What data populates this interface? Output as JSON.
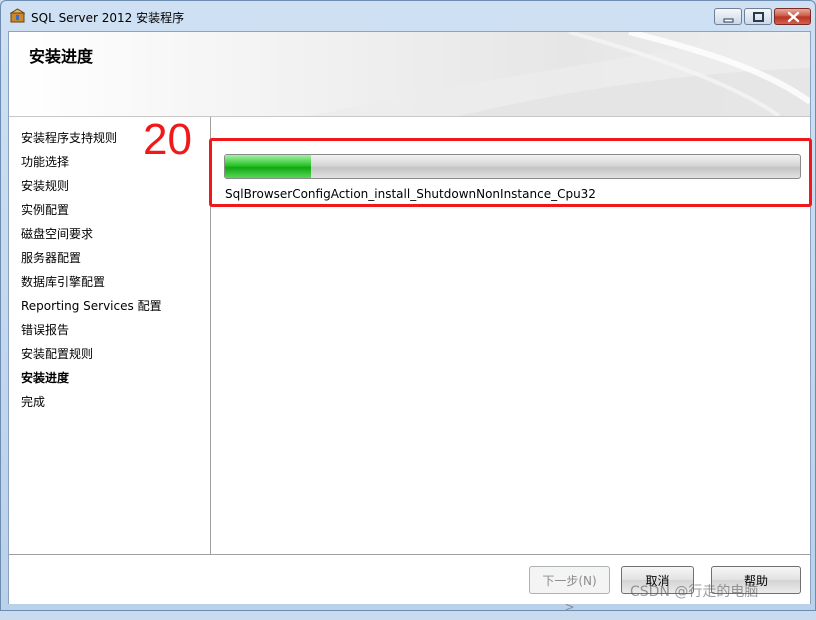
{
  "window": {
    "title": "SQL Server 2012 安装程序"
  },
  "header": {
    "title": "安装进度"
  },
  "nav": {
    "items": [
      {
        "label": "安装程序支持规则",
        "current": false
      },
      {
        "label": "功能选择",
        "current": false
      },
      {
        "label": "安装规则",
        "current": false
      },
      {
        "label": "实例配置",
        "current": false
      },
      {
        "label": "磁盘空间要求",
        "current": false
      },
      {
        "label": "服务器配置",
        "current": false
      },
      {
        "label": "数据库引擎配置",
        "current": false
      },
      {
        "label": "Reporting Services 配置",
        "current": false
      },
      {
        "label": "错误报告",
        "current": false
      },
      {
        "label": "安装配置规则",
        "current": false
      },
      {
        "label": "安装进度",
        "current": true
      },
      {
        "label": "完成",
        "current": false
      }
    ]
  },
  "main": {
    "progress_fraction": 0.15,
    "status_text": "SqlBrowserConfigAction_install_ShutdownNonInstance_Cpu32"
  },
  "annotation": {
    "number": "20",
    "color": "#f01818"
  },
  "footer": {
    "next_label": "下一步(N) >",
    "cancel_label": "取消",
    "help_label": "帮助"
  },
  "watermark": "CSDN @行走的电脑",
  "colors": {
    "progress_green": "#13a713",
    "highlight_red": "#f01818"
  }
}
